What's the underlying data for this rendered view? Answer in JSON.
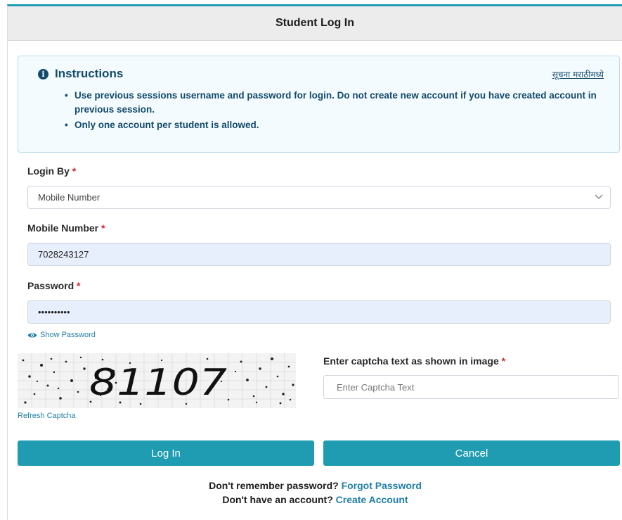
{
  "header": {
    "title": "Student Log In"
  },
  "instructions": {
    "title": "Instructions",
    "lang_link": "सूचना मराठीमध्ये",
    "items": [
      "Use previous sessions username and password for login. Do not create new account if you have created account in previous session.",
      "Only one account per student is allowed."
    ]
  },
  "form": {
    "login_by": {
      "label": "Login By",
      "required": "*",
      "value": "Mobile Number"
    },
    "mobile": {
      "label": "Mobile Number",
      "required": "*",
      "value": "7028243127"
    },
    "password": {
      "label": "Password",
      "required": "*",
      "value": "••••••••••",
      "show_label": "Show Password"
    },
    "captcha": {
      "image_text": "81107",
      "refresh_label": "Refresh Captcha",
      "label": "Enter captcha text as shown in image",
      "required": "*",
      "placeholder": "Enter Captcha Text"
    }
  },
  "buttons": {
    "login": "Log In",
    "cancel": "Cancel"
  },
  "footer": {
    "forgot_prefix": "Don't remember password?",
    "forgot_link": "Forgot Password",
    "create_prefix": "Don't have an account?",
    "create_link": "Create Account"
  },
  "colors": {
    "accent": "#1f9cb1",
    "instruction_text": "#124a6c",
    "required": "#d9232d",
    "link": "#1f7fa8"
  }
}
